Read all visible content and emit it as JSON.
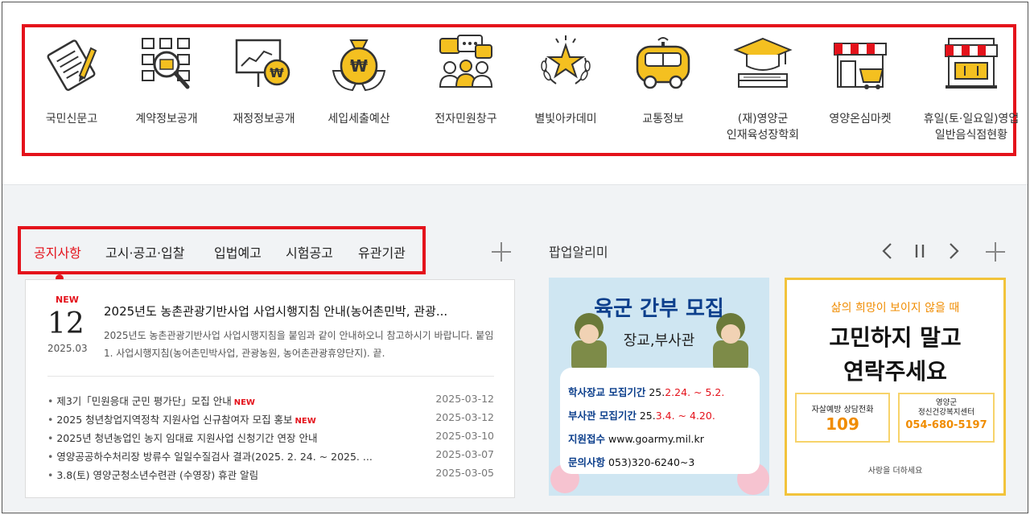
{
  "quick_menu": [
    {
      "label": "국민신문고",
      "icon": "petition-document-icon"
    },
    {
      "label": "계약정보공개",
      "icon": "contract-search-icon"
    },
    {
      "label": "재정정보공개",
      "icon": "finance-chart-icon"
    },
    {
      "label": "세입세출예산",
      "icon": "budget-moneybag-icon"
    },
    {
      "label": "전자민원창구",
      "icon": "civil-complaint-chat-icon"
    },
    {
      "label": "별빛아카데미",
      "icon": "star-laurel-icon"
    },
    {
      "label": "교통정보",
      "icon": "bus-icon"
    },
    {
      "label": "(재)영양군\n인재육성장학회",
      "icon": "graduation-cap-icon"
    },
    {
      "label": "영양온심마켓",
      "icon": "market-store-icon"
    },
    {
      "label": "휴일(토·일요일)영업\n일반음식점현황",
      "icon": "restaurant-store-icon"
    }
  ],
  "notice": {
    "tabs": [
      "공지사항",
      "고시·공고·입찰",
      "입법예고",
      "시험공고",
      "유관기관"
    ],
    "active_tab": "공지사항",
    "featured": {
      "badge": "NEW",
      "day": "12",
      "year_month": "2025.03",
      "title": "2025년도 농촌관광기반사업 사업시행지침 안내(농어촌민박, 관광...",
      "summary": "2025년도 농촌관광기반사업 사업시행지침을 붙임과 같이 안내하오니 참고하시기 바랍니다. 붙임 1. 사업시행지침(농어촌민박사업, 관광농원, 농어촌관광휴양단지). 끝."
    },
    "items": [
      {
        "title": "제3기「민원응대 군민 평가단」모집 안내",
        "new": "NEW",
        "date": "2025-03-12"
      },
      {
        "title": "2025 청년창업지역정착 지원사업 신규참여자 모집 홍보",
        "new": "NEW",
        "date": "2025-03-12"
      },
      {
        "title": "2025년 청년농업인 농지 임대료 지원사업 신청기간 연장 안내",
        "new": "",
        "date": "2025-03-10"
      },
      {
        "title": "영양공공하수처리장 방류수 일일수질검사 결과(2025. 2. 24. ~ 2025. ...",
        "new": "",
        "date": "2025-03-07"
      },
      {
        "title": "3.8(토) 영양군청소년수련관 (수영장) 휴관 알림",
        "new": "",
        "date": "2025-03-05"
      }
    ]
  },
  "popup": {
    "title": "팝업알리미",
    "banner1": {
      "headline": "육군 간부 모집",
      "sub": "장교,부사관",
      "rows": [
        {
          "label": "학사장교 모집기간",
          "value_prefix": "25.",
          "value_highlight": "2.24. ~ 5.2."
        },
        {
          "label": "부사관 모집기간",
          "value_prefix": "25.",
          "value_highlight": "3.4. ~ 4.20."
        },
        {
          "label": "지원접수",
          "value_prefix": "www.goarmy.mil.kr",
          "value_highlight": ""
        },
        {
          "label": "문의사항",
          "value_prefix": "053)320-6240~3",
          "value_highlight": ""
        }
      ]
    },
    "banner2": {
      "top": "삶의 희망이 보이지 않을 때",
      "line1": "고민하지 말고",
      "line2": "연락주세요",
      "box1_label": "자살예방 상담전화",
      "box1_value": "109",
      "box2_label": "영양군\n정신건강복지센터",
      "box2_value": "054-680-5197",
      "footer": "사랑을 더하세요"
    }
  },
  "colors": {
    "accent": "#e4121b",
    "icon_yellow": "#f4c020",
    "banner_border": "#f2c33b",
    "banner_orange": "#f08c00"
  }
}
